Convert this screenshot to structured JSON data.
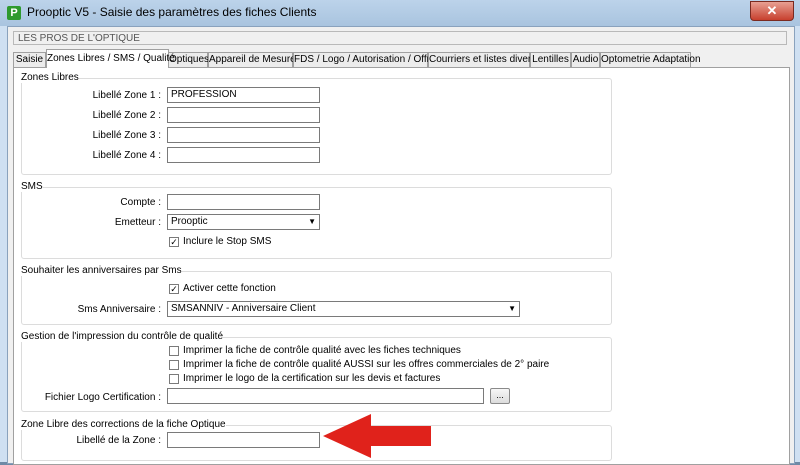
{
  "window": {
    "title": "Prooptic V5 - Saisie des paramètres des fiches Clients",
    "close_label": "✕"
  },
  "header_text": "LES PROS DE L'OPTIQUE",
  "tabs": [
    {
      "label": "Saisie"
    },
    {
      "label": "Zones Libres / SMS / Qualité",
      "active": true
    },
    {
      "label": "Optiques"
    },
    {
      "label": "Appareil de Mesures"
    },
    {
      "label": "FDS / Logo / Autorisation / Offres"
    },
    {
      "label": "Courriers et listes diverses"
    },
    {
      "label": "Lentilles"
    },
    {
      "label": "Audio"
    },
    {
      "label": "Optometrie Adaptation"
    }
  ],
  "zones_libres": {
    "title": "Zones Libres",
    "fields": [
      {
        "label": "Libellé Zone 1 :",
        "value": "PROFESSION"
      },
      {
        "label": "Libellé Zone 2 :",
        "value": ""
      },
      {
        "label": "Libellé Zone 3 :",
        "value": ""
      },
      {
        "label": "Libellé Zone 4 :",
        "value": ""
      }
    ]
  },
  "sms": {
    "title": "SMS",
    "compte_label": "Compte :",
    "compte_value": "",
    "emetteur_label": "Emetteur :",
    "emetteur_value": "Prooptic",
    "stop_label": "Inclure le Stop SMS",
    "stop_checked": true
  },
  "anniversaires": {
    "title": "Souhaiter les anniversaires par Sms",
    "activer_label": "Activer cette fonction",
    "activer_checked": true,
    "sms_label": "Sms Anniversaire :",
    "sms_value": "SMSANNIV - Anniversaire Client"
  },
  "qualite": {
    "title": "Gestion de l'impression du contrôle de qualité",
    "options": [
      {
        "label": "Imprimer la fiche de contrôle qualité avec les fiches techniques",
        "checked": false
      },
      {
        "label": "Imprimer la fiche de contrôle qualité AUSSI sur les offres commerciales de 2° paire",
        "checked": false
      },
      {
        "label": "Imprimer le logo de la certification sur les devis et factures",
        "checked": false
      }
    ],
    "logo_label": "Fichier Logo Certification :",
    "logo_value": "",
    "browse_label": "..."
  },
  "corrections": {
    "title": "Zone Libre des corrections de la fiche Optique",
    "zone_label": "Libellé de la Zone :",
    "zone_value": ""
  },
  "colors": {
    "annotation_arrow": "#e0221b",
    "titlebar": "#bcd3ea"
  }
}
